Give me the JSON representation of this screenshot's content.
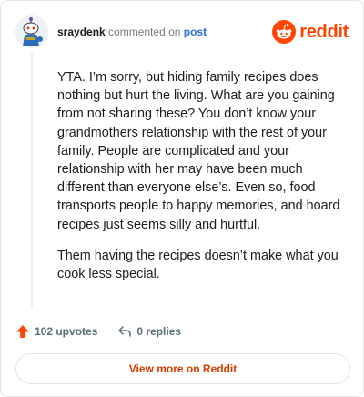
{
  "header": {
    "username": "sraydenk",
    "action_text": "commented on",
    "post_link": "post",
    "brand_name": "reddit",
    "brand_color": "#ff4500"
  },
  "comment": {
    "paragraphs": [
      "YTA. I’m sorry, but hiding family recipes does nothing but hurt the living. What are you gaining from not sharing these? You don’t know your grandmothers relationship with the rest of your family. People are complicated and your relationship with her may have been much different than everyone else’s. Even so, food transports people to happy memories, and hoard recipes just seems silly and hurtful.",
      "Them having the recipes doesn’t make what you cook less special."
    ]
  },
  "actions": {
    "upvotes_label": "102 upvotes",
    "upvote_icon": "upvote-arrow-icon",
    "replies_label": "0 replies",
    "reply_icon": "reply-icon"
  },
  "footer": {
    "view_more_label": "View more on Reddit"
  }
}
